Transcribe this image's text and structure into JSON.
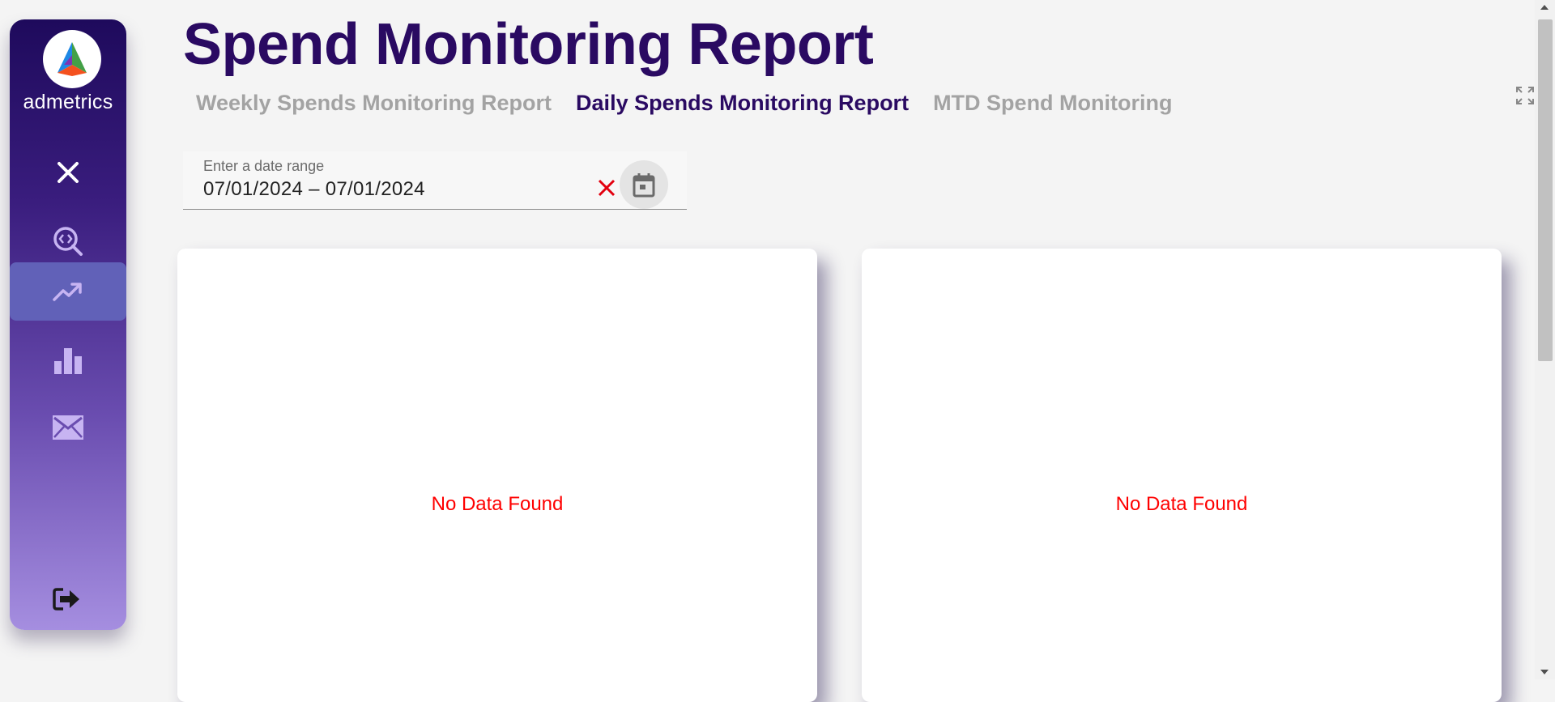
{
  "app": {
    "brand_name": "admetrics"
  },
  "sidebar": {
    "items": [
      {
        "icon": "close-icon",
        "active": false
      },
      {
        "icon": "code-search-icon",
        "active": false
      },
      {
        "icon": "trending-up-icon",
        "active": true
      },
      {
        "icon": "bar-chart-icon",
        "active": false
      },
      {
        "icon": "mail-icon",
        "active": false
      }
    ],
    "logout_icon": "logout-icon"
  },
  "header": {
    "title": "Spend Monitoring Report",
    "tabs": [
      {
        "label": "Weekly Spends Monitoring Report",
        "active": false
      },
      {
        "label": "Daily Spends Monitoring Report",
        "active": true
      },
      {
        "label": "MTD Spend Monitoring",
        "active": false
      }
    ],
    "fullscreen_icon": "fullscreen-icon"
  },
  "filters": {
    "date_range": {
      "label": "Enter a date range",
      "value": "07/01/2024 – 07/01/2024"
    }
  },
  "panels": [
    {
      "message": "No Data Found"
    },
    {
      "message": "No Data Found"
    }
  ],
  "colors": {
    "title": "#2a0a62",
    "tab_inactive": "#a3a3a3",
    "no_data": "#ff0000",
    "sidebar_active": "#6161b8"
  }
}
